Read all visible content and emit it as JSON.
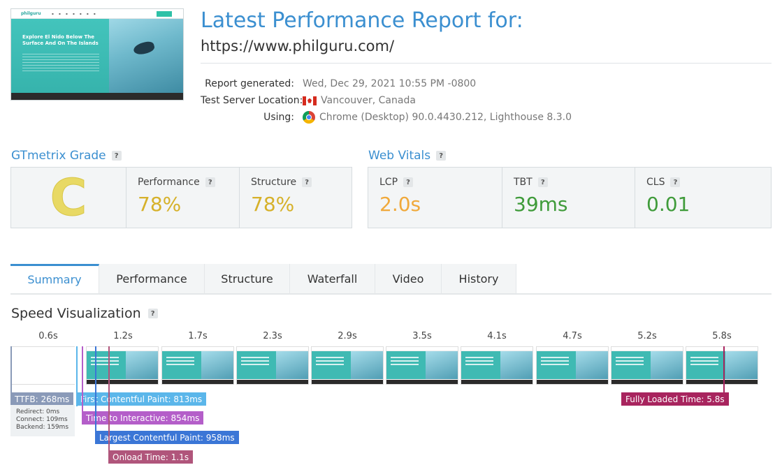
{
  "header": {
    "title": "Latest Performance Report for:",
    "url": "https://www.philguru.com/",
    "thumbnail": {
      "logo": "philguru",
      "headline": "Explore El Nido Below The Surface And On The Islands"
    },
    "meta": [
      {
        "label": "Report generated:",
        "value": "Wed, Dec 29, 2021 10:55 PM -0800",
        "icon": ""
      },
      {
        "label": "Test Server Location:",
        "value": "Vancouver, Canada",
        "icon": "canada-flag-icon"
      },
      {
        "label": "Using:",
        "value": "Chrome (Desktop) 90.0.4430.212, Lighthouse 8.3.0",
        "icon": "chrome-icon"
      }
    ]
  },
  "grade": {
    "heading": "GTmetrix Grade",
    "letter": "C",
    "performance_label": "Performance",
    "performance_value": "78%",
    "structure_label": "Structure",
    "structure_value": "78%"
  },
  "vitals": {
    "heading": "Web Vitals",
    "lcp_label": "LCP",
    "lcp_value": "2.0s",
    "tbt_label": "TBT",
    "tbt_value": "39ms",
    "cls_label": "CLS",
    "cls_value": "0.01"
  },
  "tabs": [
    {
      "label": "Summary",
      "active": true
    },
    {
      "label": "Performance",
      "active": false
    },
    {
      "label": "Structure",
      "active": false
    },
    {
      "label": "Waterfall",
      "active": false
    },
    {
      "label": "Video",
      "active": false
    },
    {
      "label": "History",
      "active": false
    }
  ],
  "speed": {
    "title": "Speed Visualization",
    "ticks": [
      "0.6s",
      "1.2s",
      "1.7s",
      "2.3s",
      "2.9s",
      "3.5s",
      "4.1s",
      "4.7s",
      "5.2s",
      "5.8s"
    ],
    "ttfb": {
      "label": "TTFB: 268ms",
      "redirect": "Redirect: 0ms",
      "connect": "Connect: 109ms",
      "backend": "Backend: 159ms"
    },
    "fcp_label": "First Contentful Paint: 813ms",
    "tti_label": "Time to Interactive: 854ms",
    "lcp_label": "Largest Contentful Paint: 958ms",
    "onload_label": "Onload Time: 1.1s",
    "fully_loaded_label": "Fully Loaded Time: 5.8s"
  },
  "colors": {
    "accent": "#3b8fd0",
    "grade_c": "#e8d964",
    "perf_yellow": "#d6b12a",
    "lcp_orange": "#f0a93b",
    "good_green": "#3f9b3a",
    "ttfb": "#8a9ab8",
    "fcp": "#5bb6ea",
    "tti": "#b45ec9",
    "lcp_marker": "#3b76d6",
    "onload": "#b0557b",
    "fully": "#a8245e"
  }
}
